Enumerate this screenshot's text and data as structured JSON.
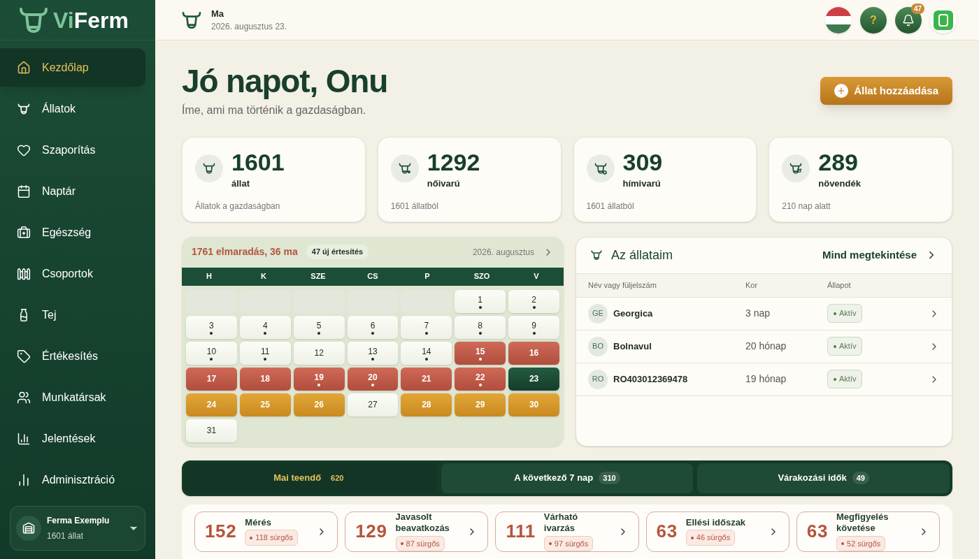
{
  "brand": {
    "name_prefix": "Vi",
    "name_suffix": "Ferm"
  },
  "sidebar": {
    "items": [
      {
        "label": "Kezdőlap",
        "selected": true
      },
      {
        "label": "Állatok",
        "selected": false
      },
      {
        "label": "Szaporítás",
        "selected": false
      },
      {
        "label": "Naptár",
        "selected": false
      },
      {
        "label": "Egészség",
        "selected": false
      },
      {
        "label": "Csoportok",
        "selected": false
      },
      {
        "label": "Tej",
        "selected": false
      },
      {
        "label": "Értékesítés",
        "selected": false
      },
      {
        "label": "Munkatársak",
        "selected": false
      },
      {
        "label": "Jelentések",
        "selected": false
      },
      {
        "label": "Adminisztráció",
        "selected": false
      }
    ],
    "farm": {
      "name": "Ferma Exemplu",
      "count": "1601 állat"
    }
  },
  "header": {
    "title": "Ma",
    "date": "2026. augusztus 23.",
    "help": "?",
    "notifications": "47"
  },
  "greeting": {
    "title": "Jó napot, Onu",
    "subtitle": "Íme, ami ma történik a gazdaságban.",
    "add_button": "Állat hozzáadása"
  },
  "stats": [
    {
      "kind": "all",
      "value": "1601",
      "label": "állat",
      "note": "Állatok a gazdaságban"
    },
    {
      "kind": "female",
      "value": "1292",
      "label": "nőivarú",
      "note": "1601 állatból"
    },
    {
      "kind": "male",
      "value": "309",
      "label": "hímivarú",
      "note": "1601 állatból"
    },
    {
      "kind": "young",
      "value": "289",
      "label": "növendék",
      "note": "210 nap alatt"
    }
  ],
  "calendar": {
    "summary": "1761 elmaradás, 36 ma",
    "notifications": "47 új értesítés",
    "month": "2026. augusztus",
    "weekdays": [
      "H",
      "K",
      "SZE",
      "CS",
      "P",
      "SZO",
      "V"
    ],
    "days": [
      {
        "kind": "empty"
      },
      {
        "kind": "empty"
      },
      {
        "kind": "empty"
      },
      {
        "kind": "empty"
      },
      {
        "kind": "empty"
      },
      {
        "kind": "normal",
        "label": "1",
        "dot": true
      },
      {
        "kind": "normal",
        "label": "2",
        "dot": true
      },
      {
        "kind": "normal",
        "label": "3",
        "dot": true
      },
      {
        "kind": "normal",
        "label": "4",
        "dot": true
      },
      {
        "kind": "normal",
        "label": "5",
        "dot": true
      },
      {
        "kind": "normal",
        "label": "6",
        "dot": true
      },
      {
        "kind": "normal",
        "label": "7",
        "dot": true
      },
      {
        "kind": "normal",
        "label": "8",
        "dot": true
      },
      {
        "kind": "normal",
        "label": "9",
        "dot": true
      },
      {
        "kind": "normal",
        "label": "10",
        "dot": true
      },
      {
        "kind": "normal",
        "label": "11",
        "dot": true
      },
      {
        "kind": "normal",
        "label": "12",
        "dot": false
      },
      {
        "kind": "normal",
        "label": "13",
        "dot": true
      },
      {
        "kind": "normal",
        "label": "14",
        "dot": true
      },
      {
        "kind": "overdue",
        "label": "15",
        "dot": true
      },
      {
        "kind": "overdue",
        "label": "16",
        "dot": false
      },
      {
        "kind": "overdue",
        "label": "17",
        "dot": false
      },
      {
        "kind": "overdue",
        "label": "18",
        "dot": false
      },
      {
        "kind": "overdue",
        "label": "19",
        "dot": true
      },
      {
        "kind": "overdue",
        "label": "20",
        "dot": true
      },
      {
        "kind": "overdue",
        "label": "21",
        "dot": false
      },
      {
        "kind": "overdue",
        "label": "22",
        "dot": true
      },
      {
        "kind": "today",
        "label": "23",
        "dot": false
      },
      {
        "kind": "upcoming",
        "label": "24",
        "dot": false
      },
      {
        "kind": "upcoming",
        "label": "25",
        "dot": false
      },
      {
        "kind": "upcoming",
        "label": "26",
        "dot": false
      },
      {
        "kind": "normal",
        "label": "27",
        "dot": false
      },
      {
        "kind": "upcoming",
        "label": "28",
        "dot": false
      },
      {
        "kind": "upcoming",
        "label": "29",
        "dot": false
      },
      {
        "kind": "upcoming",
        "label": "30",
        "dot": false
      },
      {
        "kind": "normal",
        "label": "31",
        "dot": false
      }
    ]
  },
  "animals": {
    "title": "Az állataim",
    "view_all": "Mind megtekintése",
    "columns": [
      "Név vagy füljelszám",
      "Kor",
      "Állapot"
    ],
    "rows": [
      {
        "initials": "GE",
        "name": "Georgica",
        "age": "3 nap",
        "status": "Aktív"
      },
      {
        "initials": "BO",
        "name": "Bolnavul",
        "age": "20 hónap",
        "status": "Aktív"
      },
      {
        "initials": "RO",
        "name": "RO403012369478",
        "age": "19 hónap",
        "status": "Aktív"
      }
    ]
  },
  "task_tabs": [
    {
      "label": "Mai teendő",
      "count": "620",
      "selected": true
    },
    {
      "label": "A következő 7 nap",
      "count": "310",
      "selected": false
    },
    {
      "label": "Várakozási idők",
      "count": "49",
      "selected": false
    }
  ],
  "tasks": [
    {
      "count": "152",
      "title": "Mérés",
      "urgent": "118 sürgős"
    },
    {
      "count": "129",
      "title": "Javasolt beavatkozás",
      "urgent": "87 sürgős"
    },
    {
      "count": "111",
      "title": "Várható ivarzás",
      "urgent": "97 sürgős"
    },
    {
      "count": "63",
      "title": "Ellési időszak",
      "urgent": "46 sürgős"
    },
    {
      "count": "63",
      "title": "Megfigyelés követése",
      "urgent": "52 sürgős"
    }
  ]
}
